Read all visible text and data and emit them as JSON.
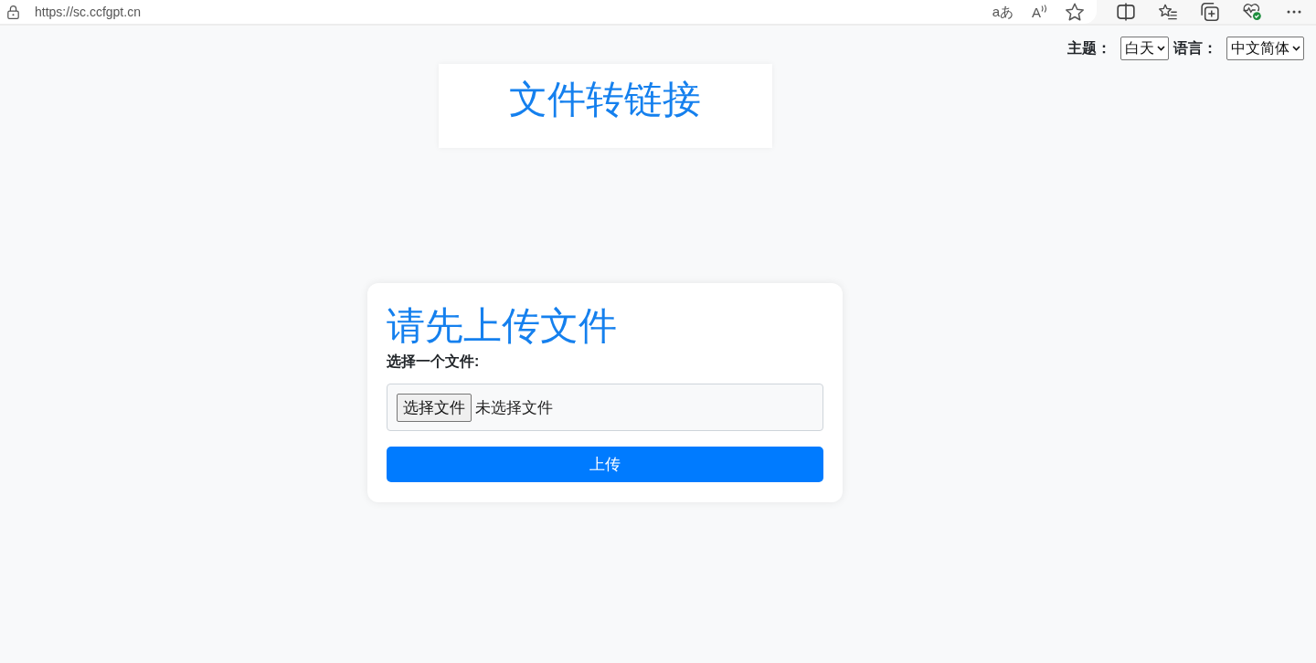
{
  "browser": {
    "url": "https://sc.ccfgpt.cn",
    "address_actions": [
      {
        "kind": "translate",
        "label": "aあ"
      },
      {
        "kind": "read_aloud",
        "label": "A"
      },
      {
        "kind": "favorite"
      }
    ],
    "toolbar": [
      {
        "kind": "split"
      },
      {
        "kind": "favorites"
      },
      {
        "kind": "collections"
      },
      {
        "kind": "health"
      },
      {
        "kind": "more"
      }
    ]
  },
  "settings": [
    {
      "label": "主题：",
      "value": "白天"
    },
    {
      "label": "语言：",
      "value": "中文简体"
    }
  ],
  "title": "文件转链接",
  "upload_card": {
    "heading": "请先上传文件",
    "label": "选择一个文件:",
    "file_input": {
      "button": "选择文件",
      "status": "未选择文件"
    },
    "submit": "上传"
  }
}
